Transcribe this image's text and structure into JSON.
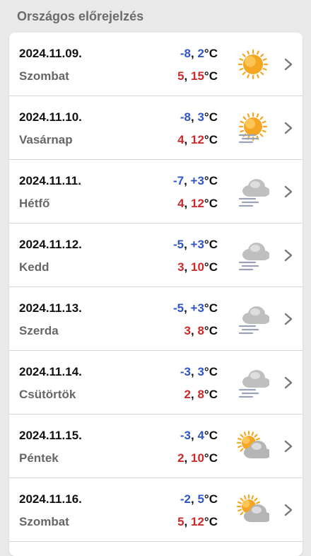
{
  "header": {
    "title": "Országos előrejelzés"
  },
  "forecast": [
    {
      "date": "2024.11.09.",
      "day": "Szombat",
      "min_a": "-8",
      "min_b": "2",
      "max_a": "5",
      "max_b": "15",
      "unit": "°C",
      "icon": "sun-icon"
    },
    {
      "date": "2024.11.10.",
      "day": "Vasárnap",
      "min_a": "-8",
      "min_b": "3",
      "max_a": "4",
      "max_b": "12",
      "unit": "°C",
      "icon": "sun-fog-icon"
    },
    {
      "date": "2024.11.11.",
      "day": "Hétfő",
      "min_a": "-7",
      "min_b": "+3",
      "max_a": "4",
      "max_b": "12",
      "unit": "°C",
      "icon": "cloud-fog-icon"
    },
    {
      "date": "2024.11.12.",
      "day": "Kedd",
      "min_a": "-5",
      "min_b": "+3",
      "max_a": "3",
      "max_b": "10",
      "unit": "°C",
      "icon": "cloud-fog-icon"
    },
    {
      "date": "2024.11.13.",
      "day": "Szerda",
      "min_a": "-5",
      "min_b": "+3",
      "max_a": "3",
      "max_b": "8",
      "unit": "°C",
      "icon": "cloud-fog-icon"
    },
    {
      "date": "2024.11.14.",
      "day": "Csütörtök",
      "min_a": "-3",
      "min_b": "3",
      "max_a": "2",
      "max_b": "8",
      "unit": "°C",
      "icon": "cloud-fog-icon"
    },
    {
      "date": "2024.11.15.",
      "day": "Péntek",
      "min_a": "-3",
      "min_b": "4",
      "max_a": "2",
      "max_b": "10",
      "unit": "°C",
      "icon": "sun-cloud-icon"
    },
    {
      "date": "2024.11.16.",
      "day": "Szombat",
      "min_a": "-2",
      "min_b": "5",
      "max_a": "5",
      "max_b": "12",
      "unit": "°C",
      "icon": "sun-cloud-icon"
    }
  ],
  "colors": {
    "min": "#2f55c6",
    "max": "#cc2a2a",
    "sun": "#f5a623",
    "cloud": "#bfbfbf"
  }
}
